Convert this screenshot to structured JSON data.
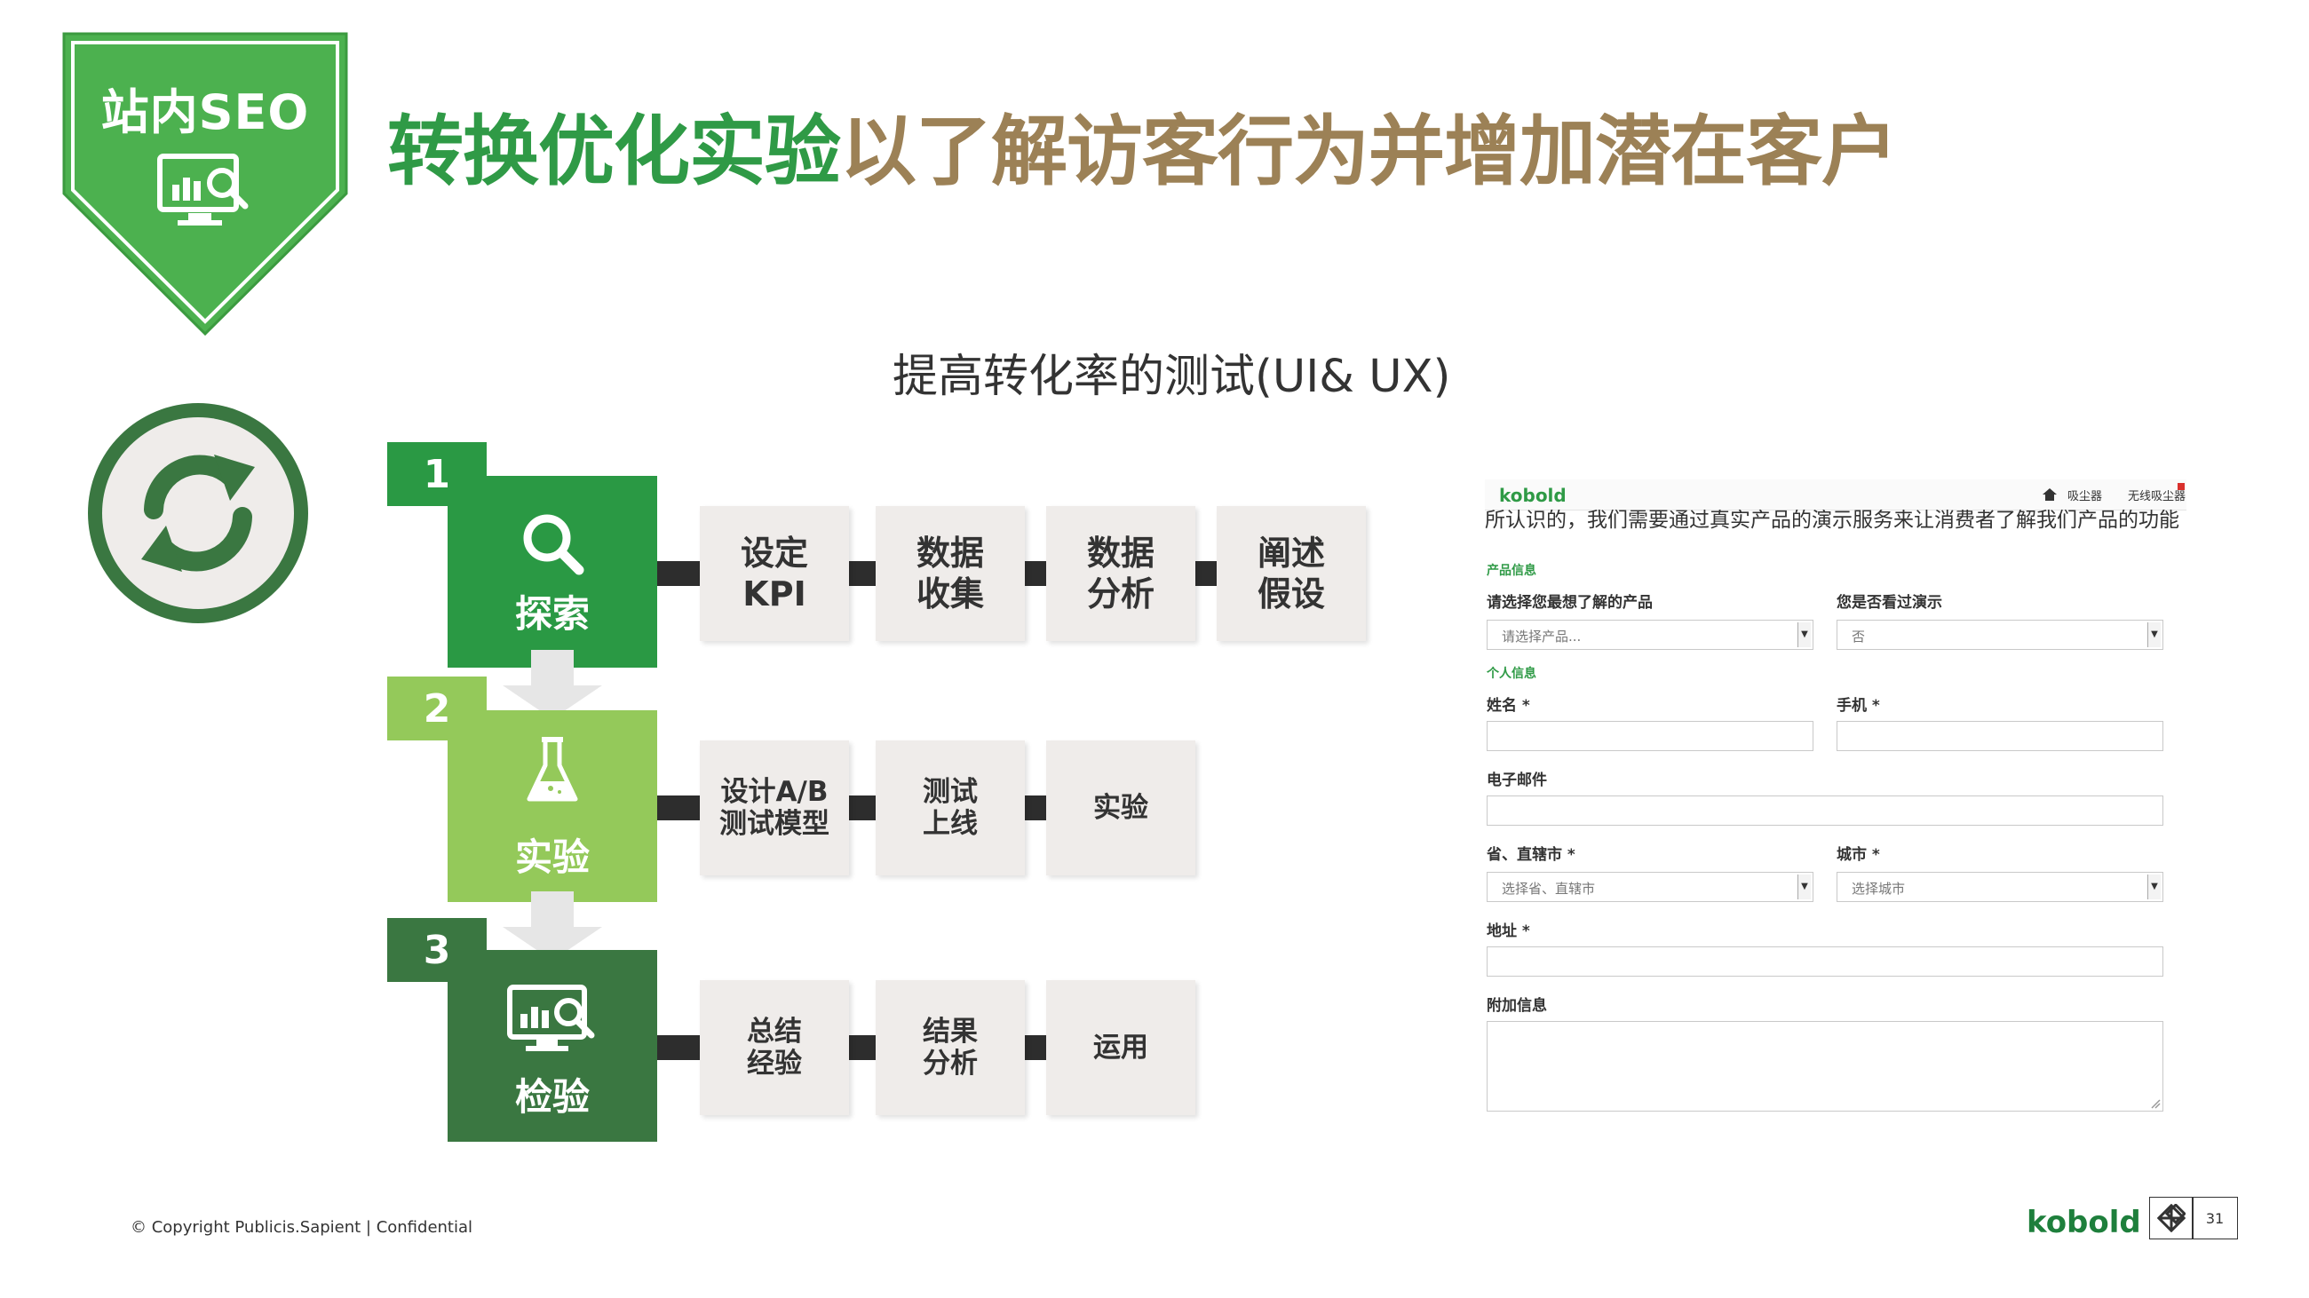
{
  "badge": {
    "label": "站内SEO",
    "icon": "chart-magnifier-icon"
  },
  "title": {
    "part_green": "转换优化实验",
    "part_olive": "以了解访客行为并增加潜在客户"
  },
  "subtitle": "提高转化率的测试(UI& UX)",
  "refresh_icon": "refresh-arrows-icon",
  "steps": [
    {
      "number": "1",
      "label": "探索",
      "icon": "magnifier-icon",
      "color": "#2a9944",
      "tasks": [
        "设定\nKPI",
        "数据\n收集",
        "数据\n分析",
        "阐述\n假设"
      ]
    },
    {
      "number": "2",
      "label": "实验",
      "icon": "flask-icon",
      "color": "#94c95a",
      "tasks": [
        "设计A/B\n测试模型",
        "测试\n上线",
        "实验"
      ]
    },
    {
      "number": "3",
      "label": "检验",
      "icon": "chart-magnifier-icon",
      "color": "#3a7741",
      "tasks": [
        "总结\n经验",
        "结果\n分析",
        "运用"
      ]
    }
  ],
  "form": {
    "brand": "kobold",
    "nav": {
      "home_icon": "home-icon",
      "item1": "吸尘器",
      "item2": "无线吸尘器"
    },
    "intro": "所认识的，我们需要通过真实产品的演示服务来让消费者了解我们产品的功能",
    "section_product": "产品信息",
    "product_label": "请选择您最想了解的产品",
    "product_value": "请选择产品...",
    "demo_label": "您是否看过演示",
    "demo_value": "否",
    "section_personal": "个人信息",
    "name_label": "姓名 *",
    "phone_label": "手机 *",
    "email_label": "电子邮件",
    "province_label": "省、直辖市 *",
    "province_value": "选择省、直辖市",
    "city_label": "城市 *",
    "city_value": "选择城市",
    "address_label": "地址 *",
    "extra_label": "附加信息"
  },
  "footer": {
    "copyright": "© Copyright Publicis.Sapient | Confidential",
    "brand": "kobold",
    "page": "31"
  },
  "colors": {
    "green": "#2f9a46",
    "olive": "#9c8156",
    "light_green": "#94c95a",
    "dark_green": "#3a7741"
  }
}
